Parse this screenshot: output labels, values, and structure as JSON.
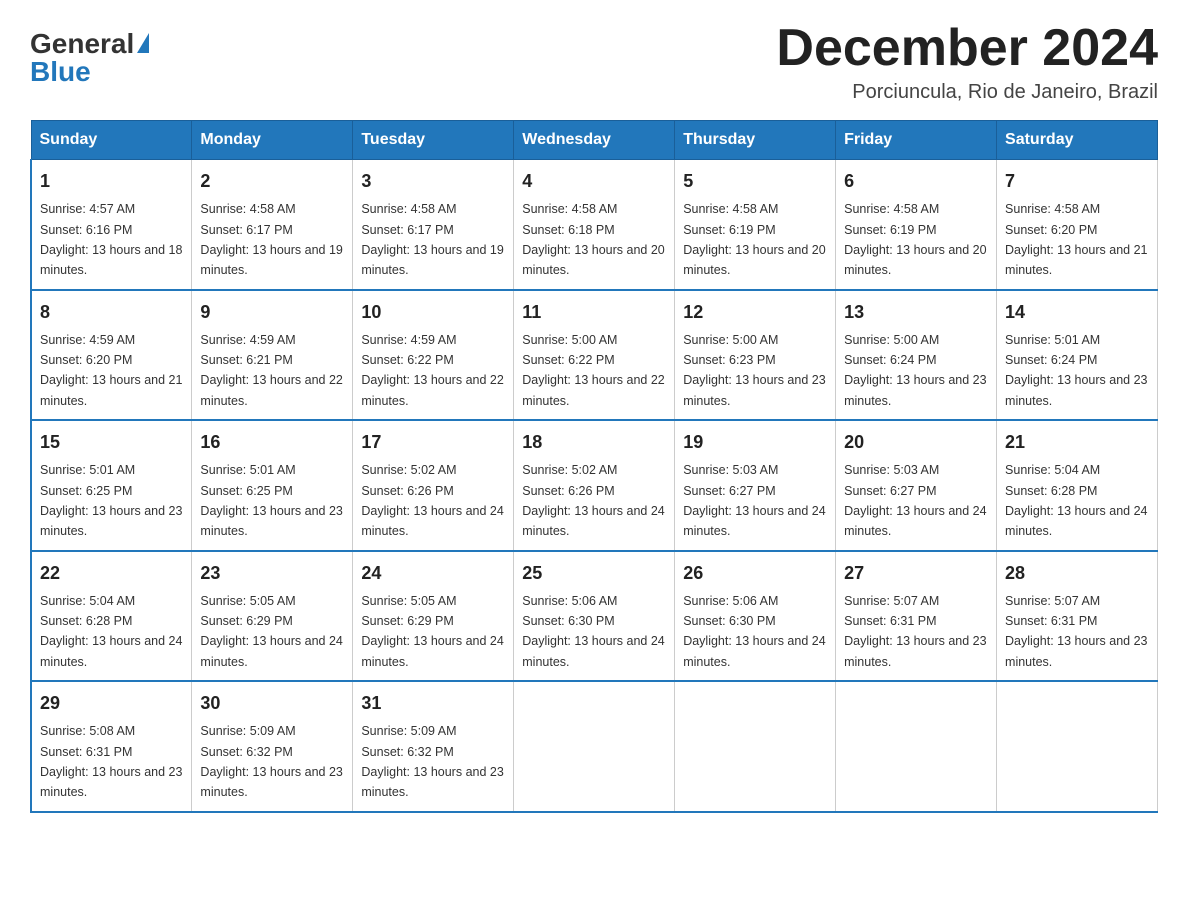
{
  "logo": {
    "general": "General",
    "blue": "Blue"
  },
  "title": "December 2024",
  "subtitle": "Porciuncula, Rio de Janeiro, Brazil",
  "weekdays": [
    "Sunday",
    "Monday",
    "Tuesday",
    "Wednesday",
    "Thursday",
    "Friday",
    "Saturday"
  ],
  "weeks": [
    [
      {
        "day": "1",
        "sunrise": "4:57 AM",
        "sunset": "6:16 PM",
        "daylight": "13 hours and 18 minutes."
      },
      {
        "day": "2",
        "sunrise": "4:58 AM",
        "sunset": "6:17 PM",
        "daylight": "13 hours and 19 minutes."
      },
      {
        "day": "3",
        "sunrise": "4:58 AM",
        "sunset": "6:17 PM",
        "daylight": "13 hours and 19 minutes."
      },
      {
        "day": "4",
        "sunrise": "4:58 AM",
        "sunset": "6:18 PM",
        "daylight": "13 hours and 20 minutes."
      },
      {
        "day": "5",
        "sunrise": "4:58 AM",
        "sunset": "6:19 PM",
        "daylight": "13 hours and 20 minutes."
      },
      {
        "day": "6",
        "sunrise": "4:58 AM",
        "sunset": "6:19 PM",
        "daylight": "13 hours and 20 minutes."
      },
      {
        "day": "7",
        "sunrise": "4:58 AM",
        "sunset": "6:20 PM",
        "daylight": "13 hours and 21 minutes."
      }
    ],
    [
      {
        "day": "8",
        "sunrise": "4:59 AM",
        "sunset": "6:20 PM",
        "daylight": "13 hours and 21 minutes."
      },
      {
        "day": "9",
        "sunrise": "4:59 AM",
        "sunset": "6:21 PM",
        "daylight": "13 hours and 22 minutes."
      },
      {
        "day": "10",
        "sunrise": "4:59 AM",
        "sunset": "6:22 PM",
        "daylight": "13 hours and 22 minutes."
      },
      {
        "day": "11",
        "sunrise": "5:00 AM",
        "sunset": "6:22 PM",
        "daylight": "13 hours and 22 minutes."
      },
      {
        "day": "12",
        "sunrise": "5:00 AM",
        "sunset": "6:23 PM",
        "daylight": "13 hours and 23 minutes."
      },
      {
        "day": "13",
        "sunrise": "5:00 AM",
        "sunset": "6:24 PM",
        "daylight": "13 hours and 23 minutes."
      },
      {
        "day": "14",
        "sunrise": "5:01 AM",
        "sunset": "6:24 PM",
        "daylight": "13 hours and 23 minutes."
      }
    ],
    [
      {
        "day": "15",
        "sunrise": "5:01 AM",
        "sunset": "6:25 PM",
        "daylight": "13 hours and 23 minutes."
      },
      {
        "day": "16",
        "sunrise": "5:01 AM",
        "sunset": "6:25 PM",
        "daylight": "13 hours and 23 minutes."
      },
      {
        "day": "17",
        "sunrise": "5:02 AM",
        "sunset": "6:26 PM",
        "daylight": "13 hours and 24 minutes."
      },
      {
        "day": "18",
        "sunrise": "5:02 AM",
        "sunset": "6:26 PM",
        "daylight": "13 hours and 24 minutes."
      },
      {
        "day": "19",
        "sunrise": "5:03 AM",
        "sunset": "6:27 PM",
        "daylight": "13 hours and 24 minutes."
      },
      {
        "day": "20",
        "sunrise": "5:03 AM",
        "sunset": "6:27 PM",
        "daylight": "13 hours and 24 minutes."
      },
      {
        "day": "21",
        "sunrise": "5:04 AM",
        "sunset": "6:28 PM",
        "daylight": "13 hours and 24 minutes."
      }
    ],
    [
      {
        "day": "22",
        "sunrise": "5:04 AM",
        "sunset": "6:28 PM",
        "daylight": "13 hours and 24 minutes."
      },
      {
        "day": "23",
        "sunrise": "5:05 AM",
        "sunset": "6:29 PM",
        "daylight": "13 hours and 24 minutes."
      },
      {
        "day": "24",
        "sunrise": "5:05 AM",
        "sunset": "6:29 PM",
        "daylight": "13 hours and 24 minutes."
      },
      {
        "day": "25",
        "sunrise": "5:06 AM",
        "sunset": "6:30 PM",
        "daylight": "13 hours and 24 minutes."
      },
      {
        "day": "26",
        "sunrise": "5:06 AM",
        "sunset": "6:30 PM",
        "daylight": "13 hours and 24 minutes."
      },
      {
        "day": "27",
        "sunrise": "5:07 AM",
        "sunset": "6:31 PM",
        "daylight": "13 hours and 23 minutes."
      },
      {
        "day": "28",
        "sunrise": "5:07 AM",
        "sunset": "6:31 PM",
        "daylight": "13 hours and 23 minutes."
      }
    ],
    [
      {
        "day": "29",
        "sunrise": "5:08 AM",
        "sunset": "6:31 PM",
        "daylight": "13 hours and 23 minutes."
      },
      {
        "day": "30",
        "sunrise": "5:09 AM",
        "sunset": "6:32 PM",
        "daylight": "13 hours and 23 minutes."
      },
      {
        "day": "31",
        "sunrise": "5:09 AM",
        "sunset": "6:32 PM",
        "daylight": "13 hours and 23 minutes."
      },
      null,
      null,
      null,
      null
    ]
  ]
}
